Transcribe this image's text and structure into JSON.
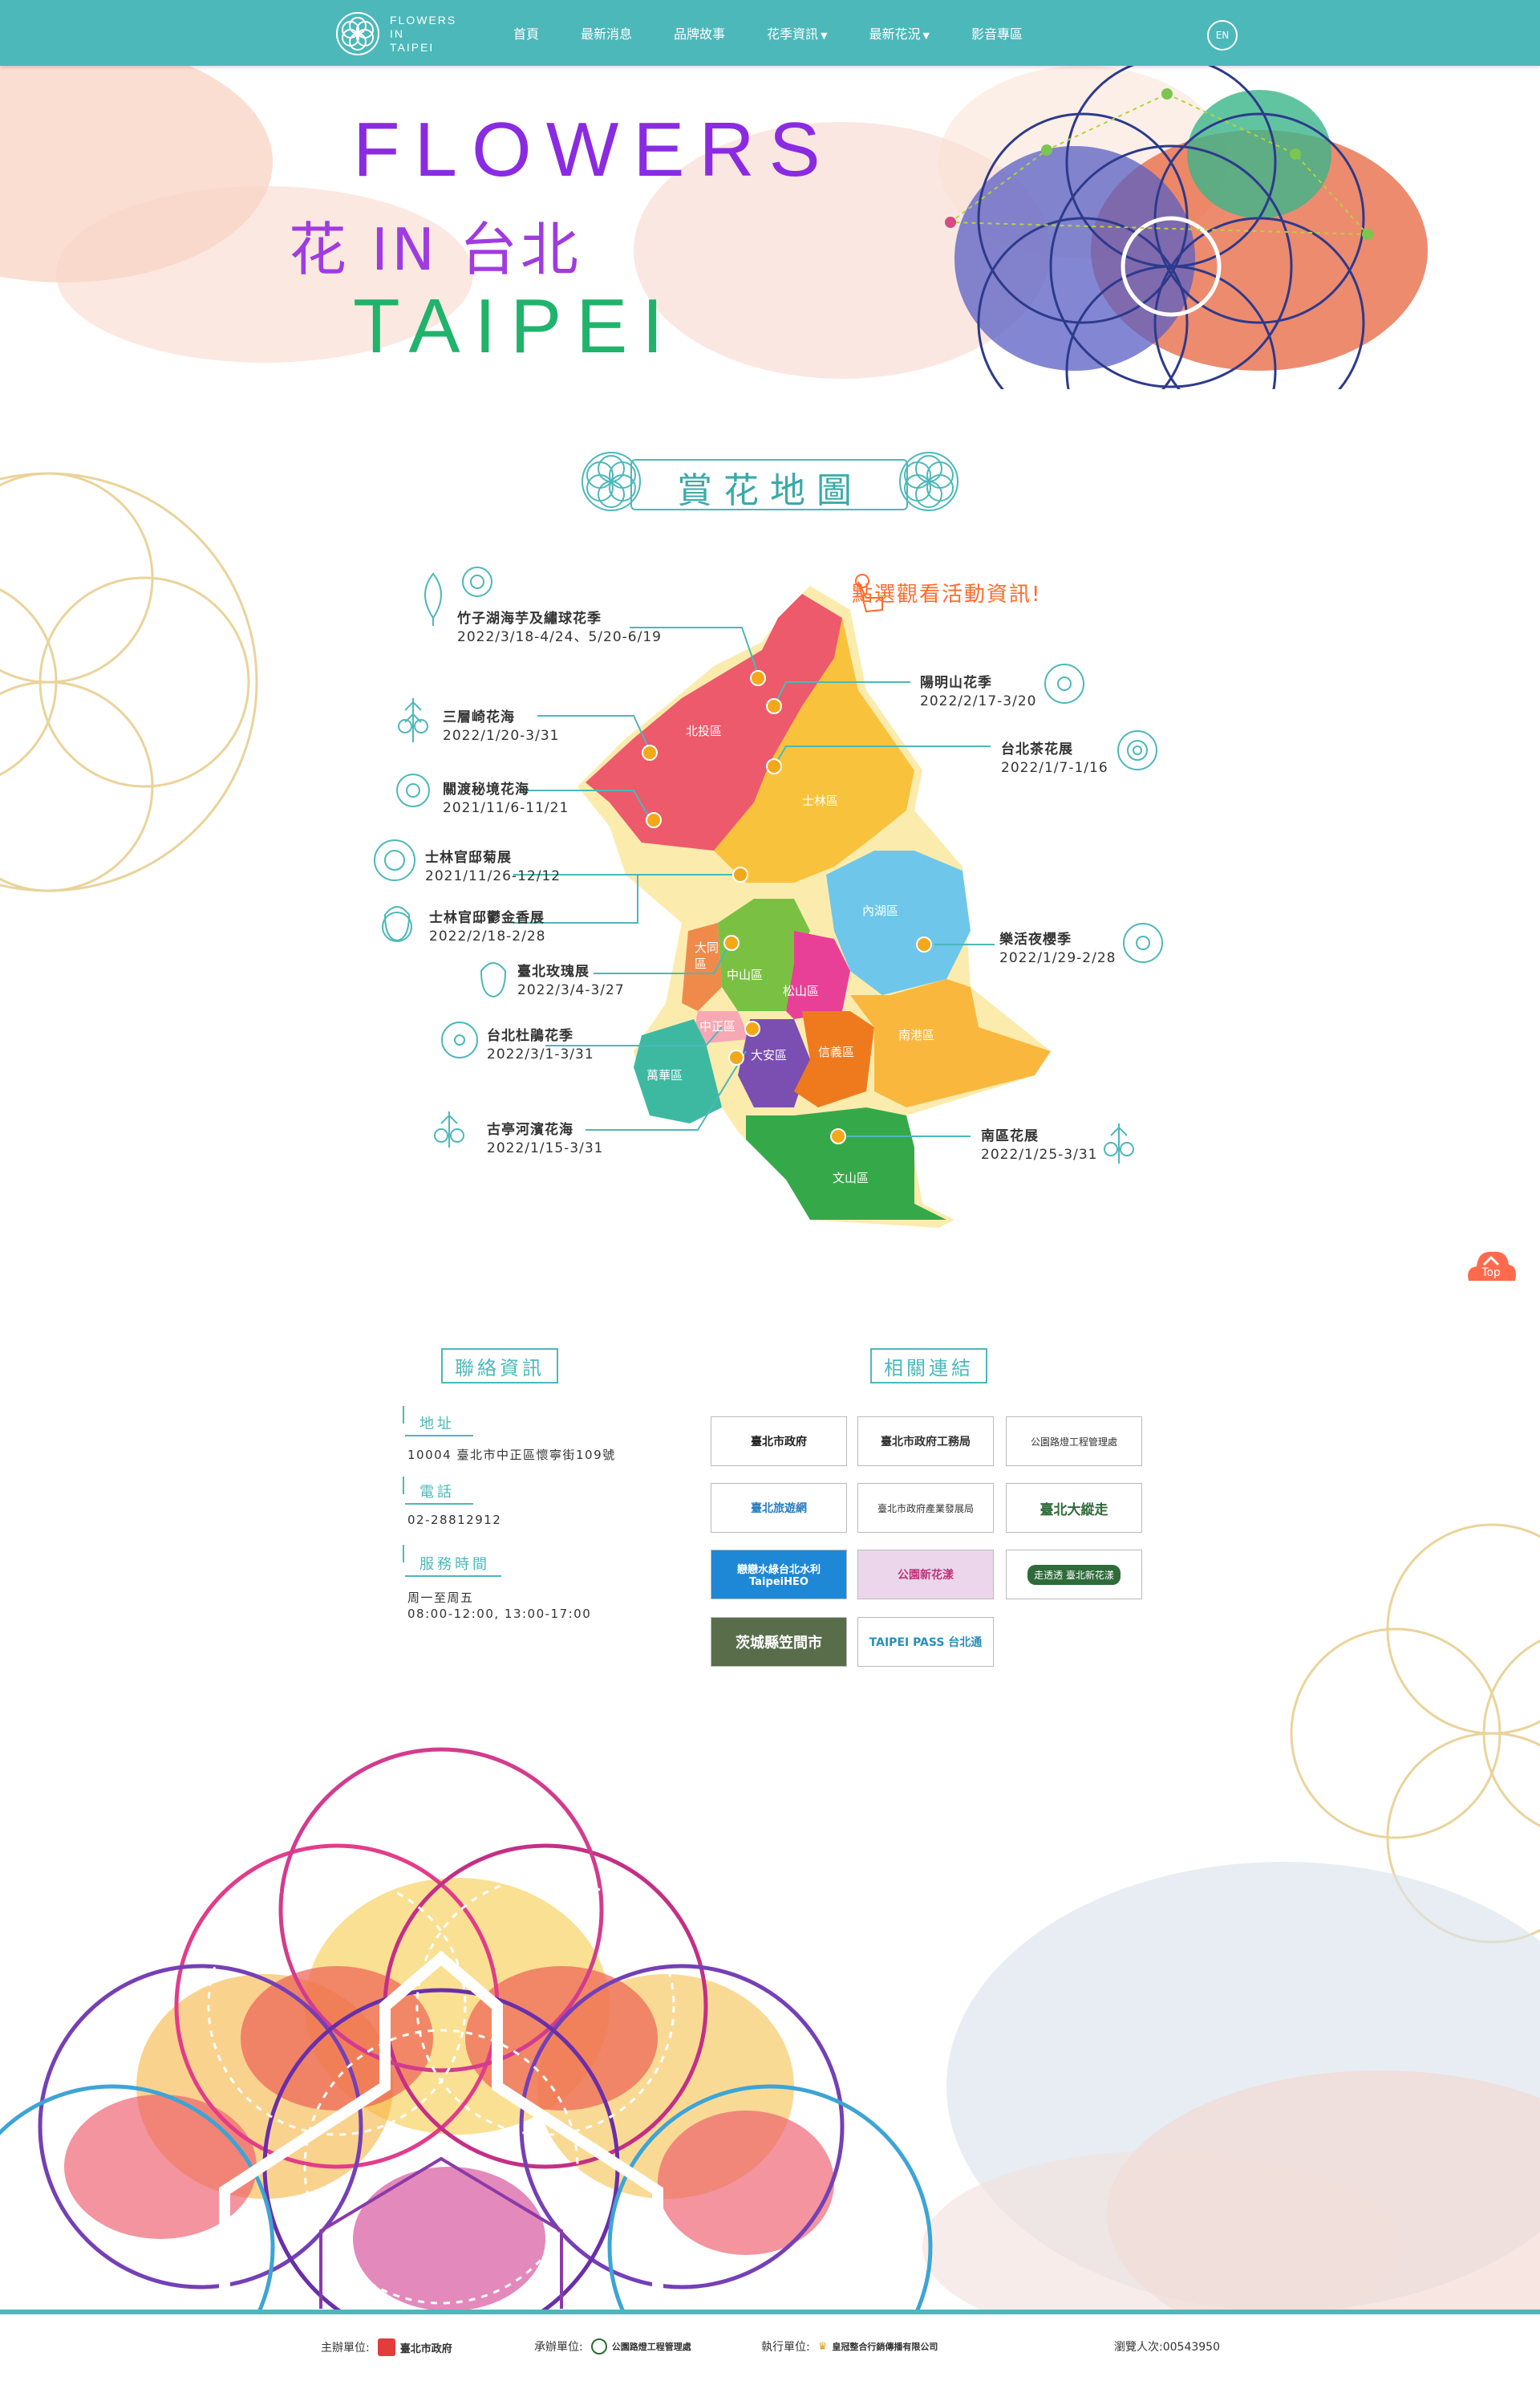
{
  "header": {
    "logo_text": [
      "FLOWERS",
      "IN",
      "TAIPEI"
    ],
    "nav": [
      {
        "label": "首頁",
        "caret": ""
      },
      {
        "label": "最新消息",
        "caret": ""
      },
      {
        "label": "品牌故事",
        "caret": ""
      },
      {
        "label": "花季資訊",
        "caret": "▼"
      },
      {
        "label": "最新花況",
        "caret": "▼"
      },
      {
        "label": "影音專區",
        "caret": ""
      }
    ],
    "lang_label": "EN"
  },
  "banner": {
    "title_line1": "FLOWERS",
    "title_line2": "花 IN 台北",
    "title_line3": "TAIPEI"
  },
  "map_section": {
    "title": "賞花地圖",
    "hint": "點選觀看活動資訊!",
    "districts": [
      "北投區",
      "士林區",
      "內湖區",
      "大同區",
      "中山區",
      "松山區",
      "中正區",
      "大安區",
      "信義區",
      "南港區",
      "萬華區",
      "文山區"
    ],
    "events": [
      {
        "name": "竹子湖海芋及繡球花季",
        "date": "2022/3/18-4/24、5/20-6/19"
      },
      {
        "name": "三層崎花海",
        "date": "2022/1/20-3/31"
      },
      {
        "name": "關渡秘境花海",
        "date": "2021/11/6-11/21"
      },
      {
        "name": "士林官邸菊展",
        "date": "2021/11/26-12/12"
      },
      {
        "name": "士林官邸鬱金香展",
        "date": "2022/2/18-2/28"
      },
      {
        "name": "臺北玫瑰展",
        "date": "2022/3/4-3/27"
      },
      {
        "name": "台北杜鵑花季",
        "date": "2022/3/1-3/31"
      },
      {
        "name": "古亭河濱花海",
        "date": "2022/1/15-3/31"
      },
      {
        "name": "陽明山花季",
        "date": "2022/2/17-3/20"
      },
      {
        "name": "台北茶花展",
        "date": "2022/1/7-1/16"
      },
      {
        "name": "樂活夜櫻季",
        "date": "2022/1/29-2/28"
      },
      {
        "name": "南區花展",
        "date": "2022/1/25-3/31"
      }
    ]
  },
  "contact": {
    "title": "聯絡資訊",
    "address_label": "地址",
    "address": "10004 臺北市中正區懷寧街109號",
    "phone_label": "電話",
    "phone": "02-28812912",
    "hours_label": "服務時間",
    "hours_days": "周一至周五",
    "hours_time": "08:00-12:00, 13:00-17:00"
  },
  "links": {
    "title": "相關連結",
    "items": [
      "臺北市政府",
      "臺北市政府工務局",
      "公園路燈工程管理處",
      "臺北旅遊網",
      "臺北市政府產業發展局",
      "臺北大縱走",
      "戀戀水綠台北水利 TaipeiHEO",
      "公園新花漾",
      "走透透 臺北新花漾",
      "茨城縣笠間市",
      "TAIPEI PASS 台北通"
    ]
  },
  "top_button": "Top",
  "footer": {
    "host_label": "主辦單位:",
    "host": "臺北市政府",
    "co_label": "承辦單位:",
    "co": "公園路燈工程管理處",
    "exec_label": "執行單位:",
    "exec": "皇冠整合行銷傳播有限公司",
    "visits": "瀏覽人次:00543950"
  }
}
